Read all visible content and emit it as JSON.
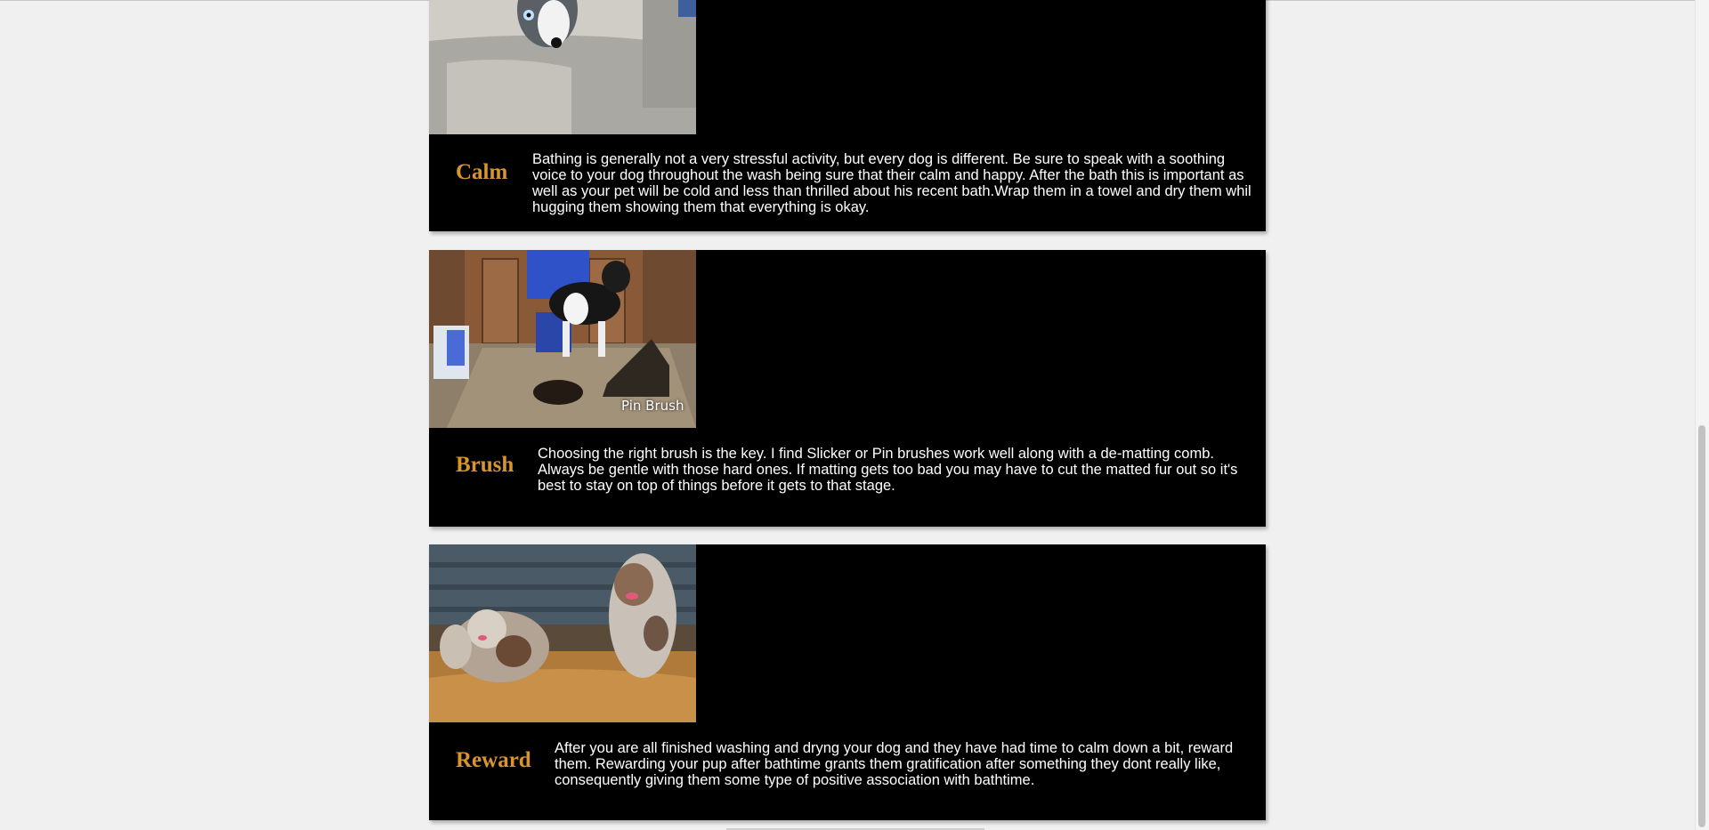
{
  "sections": [
    {
      "title": "Calm",
      "text": "Bathing is generally not a very stressful activity, but every dog is different. Be sure to speak with a soothing voice to your dog throughout the wash being sure that their calm and happy. After the bath this is important as well as your pet will be cold and less than thrilled about his recent bath.Wrap them in a towel and dry them whil hugging them showing them that everything is okay.",
      "image": "dog-in-car-seat"
    },
    {
      "title": "Brush",
      "text": "Choosing the right brush is the key. I find Slicker or Pin brushes work well along with a de-matting comb. Always be gentle with those hard ones. If matting gets too bad you may have to cut the matted fur out so it's best to stay on top of things before it gets to that stage.",
      "image": "person-brushing-dog",
      "image_caption": "Pin Brush"
    },
    {
      "title": "Reward",
      "text": "After you are all finished washing and dryng your dog and they have had time to calm down a bit, reward them. Rewarding your pup after bathtime grants them gratification after something they dont really like, consequently giving them some type of positive association with bathtime.",
      "image": "dogs-running-outdoors"
    }
  ],
  "colors": {
    "page_bg": "#f0f0f0",
    "card_bg": "#000000",
    "title": "#d8952c",
    "text": "#ffffff"
  }
}
